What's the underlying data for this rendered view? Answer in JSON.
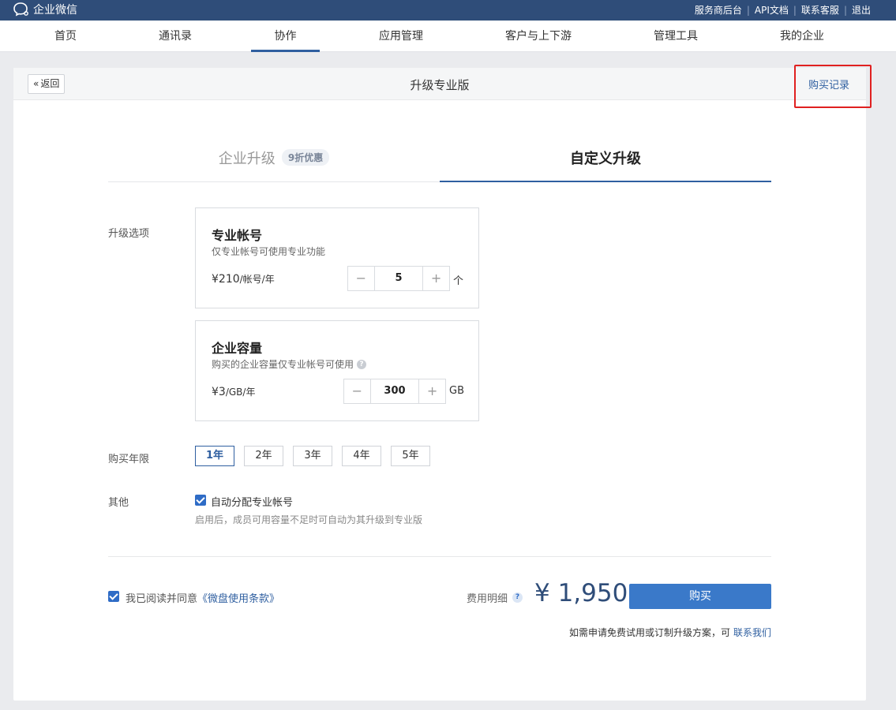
{
  "app": {
    "name": "企业微信"
  },
  "top_links": [
    "服务商后台",
    "API文档",
    "联系客服",
    "退出"
  ],
  "nav": [
    "首页",
    "通讯录",
    "协作",
    "应用管理",
    "客户与上下游",
    "管理工具",
    "我的企业"
  ],
  "nav_active": "协作",
  "header": {
    "back": "返回",
    "title": "升级专业版",
    "records": "购买记录"
  },
  "tabs": {
    "enterprise": "企业升级",
    "discount_badge": "9折优惠",
    "custom": "自定义升级"
  },
  "options": {
    "label": "升级选项",
    "account": {
      "title": "专业帐号",
      "desc": "仅专业帐号可使用专业功能",
      "price": "¥210",
      "price_unit": "/帐号/年",
      "quantity": "5",
      "unit": "个",
      "minus": "−",
      "plus": "+"
    },
    "storage": {
      "title": "企业容量",
      "desc": "购买的企业容量仅专业帐号可使用",
      "price": "¥3",
      "price_unit": "/GB/年",
      "quantity": "300",
      "unit": "GB",
      "minus": "−",
      "plus": "+"
    }
  },
  "duration": {
    "label": "购买年限",
    "years": [
      "1年",
      "2年",
      "3年",
      "4年",
      "5年"
    ],
    "selected": "1年"
  },
  "other": {
    "label": "其他",
    "checkbox_label": "自动分配专业帐号",
    "hint": "启用后，成员可用容量不足时可自动为其升级到专业版",
    "checked": true
  },
  "footer": {
    "agree_prefix": "我已阅读并同意",
    "agree_link": "《微盘使用条款》",
    "agreed": true,
    "fee_label": "费用明细",
    "total": "¥ 1,950",
    "buy": "购买",
    "note": "如需申请免费试用或订制升级方案，可",
    "contact": "联系我们"
  },
  "colors": {
    "topbar": "#2f4d79",
    "accent": "#2f5fa0",
    "buy_button": "#3a79c9",
    "highlight": "#e02020"
  }
}
